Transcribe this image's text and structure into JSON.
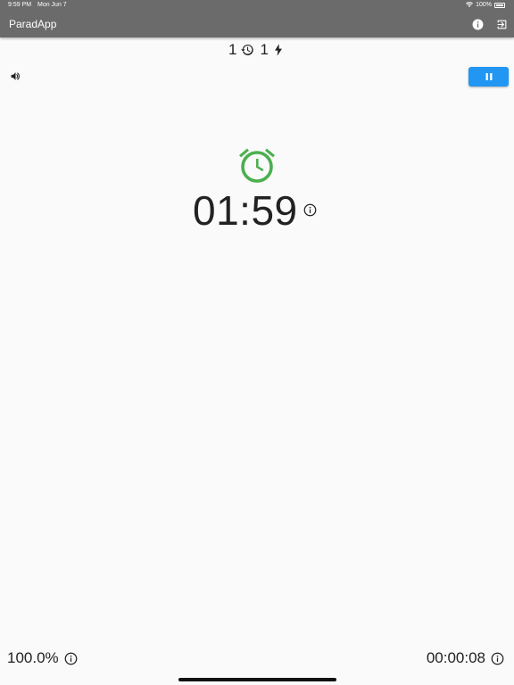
{
  "status_bar": {
    "time": "9:59 PM",
    "date": "Mon Jun 7",
    "battery": "100%"
  },
  "appbar": {
    "title": "ParadApp"
  },
  "counters": {
    "history_count": "1",
    "energy_count": "1"
  },
  "timer": {
    "value": "01:59"
  },
  "footer": {
    "percentage": "100.0%",
    "elapsed": "00:00:08"
  },
  "colors": {
    "appbar": "#6b6b6b",
    "accent": "#2196f3",
    "alarm": "#4caf50"
  },
  "icons": [
    "info-icon",
    "exit-icon",
    "history-icon",
    "bolt-icon",
    "volume-icon",
    "pause-icon",
    "alarm-clock-icon"
  ]
}
